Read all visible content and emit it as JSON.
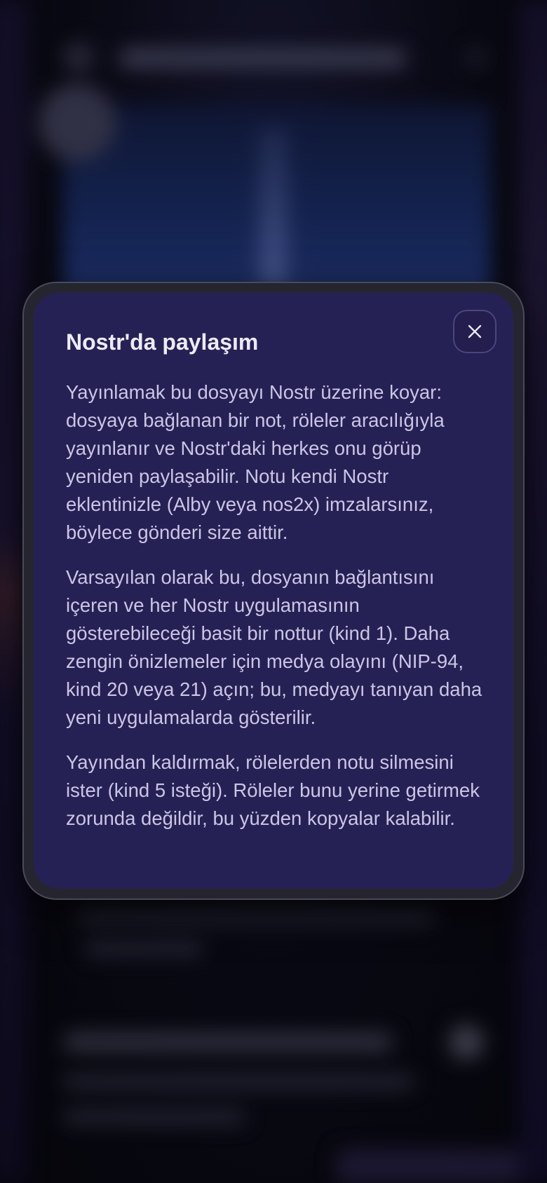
{
  "dialog": {
    "title": "Nostr'da paylaşım",
    "close_icon": "close-icon",
    "paragraphs": [
      "Yayınlamak bu dosyayı Nostr üzerine koyar: dosyaya bağlanan bir not, röleler aracılığıyla yayınlanır ve Nostr'daki herkes onu görüp yeniden paylaşabilir. Notu kendi Nostr eklentinizle (Alby veya nos2x) imzalarsınız, böylece gönderi size aittir.",
      "Varsayılan olarak bu, dosyanın bağlantısını içeren ve her Nostr uygulamasının gösterebileceği basit bir nottur (kind 1). Daha zengin önizlemeler için medya olayını (NIP-94, kind 20 veya 21) açın; bu, medyayı tanıyan daha yeni uygulamalarda gösterilir.",
      "Yayından kaldırmak, rölelerden notu silmesini ister (kind 5 isteği). Röleler bunu yerine getirmek zorunda değildir, bu yüzden kopyalar kalabilir."
    ]
  },
  "colors": {
    "modal_background": "#262154",
    "modal_frame": "#252530",
    "title_text": "#ecebf6",
    "body_text": "#c9c6e6",
    "backdrop": "#08080d"
  }
}
